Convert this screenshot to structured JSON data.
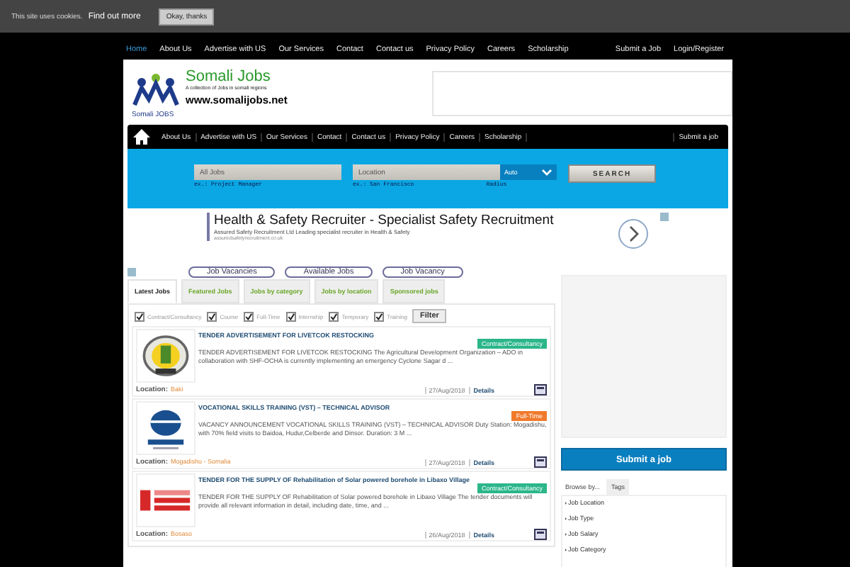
{
  "cookie_bar": {
    "text": "This site uses cookies.",
    "link": "Find out more",
    "button": "Okay, thanks"
  },
  "top_nav": {
    "items": [
      {
        "label": "Home",
        "selected": true
      },
      {
        "label": "About Us",
        "selected": false
      },
      {
        "label": "Advertise with US",
        "selected": false
      },
      {
        "label": "Our Services",
        "selected": false
      },
      {
        "label": "Contact",
        "selected": false
      },
      {
        "label": "Contact us",
        "selected": false
      },
      {
        "label": "Privacy Policy",
        "selected": false
      },
      {
        "label": "Careers",
        "selected": false
      },
      {
        "label": "Scholarship",
        "selected": false
      }
    ],
    "right": [
      "Submit a Job",
      "Login/Register"
    ]
  },
  "logo": {
    "title": "Somali Jobs",
    "tagline": "A collection of Jobs in somali regions",
    "url": "www.somalijobs.net",
    "badge": "Somali JOBS"
  },
  "main_nav": {
    "items": [
      "About Us",
      "Advertise with US",
      "Our Services",
      "Contact",
      "Contact us",
      "Privacy Policy",
      "Careers",
      "Scholarship"
    ],
    "right": "Submit a job"
  },
  "search": {
    "keyword": {
      "placeholder": "All Jobs",
      "hint": "ex.: Project Manager"
    },
    "location": {
      "placeholder": "Location",
      "hint": "ex.: San Francisco"
    },
    "radius": {
      "value": "Auto",
      "hint": "Radius"
    },
    "button": "SEARCH"
  },
  "ad": {
    "title": "Health & Safety Recruiter - Specialist Safety Recruitment",
    "text": "Assured Safety Recruitment Ltd Leading specialist recruiter in Health & Safety",
    "url": "assuredsafetyrecruitment.co.uk"
  },
  "link_buttons": [
    "Job Vacancies",
    "Available Jobs",
    "Job Vacancy"
  ],
  "tabs": [
    {
      "label": "Latest Jobs",
      "selected": true
    },
    {
      "label": "Featured Jobs",
      "selected": false
    },
    {
      "label": "Jobs by category",
      "selected": false
    },
    {
      "label": "Jobs by location",
      "selected": false
    },
    {
      "label": "Sponsored jobs",
      "selected": false
    }
  ],
  "filters": [
    {
      "label": "Contract/Consultancy",
      "checked": true
    },
    {
      "label": "Course",
      "checked": true
    },
    {
      "label": "Full-Time",
      "checked": true
    },
    {
      "label": "Internship",
      "checked": true
    },
    {
      "label": "Temporary",
      "checked": true
    },
    {
      "label": "Training",
      "checked": true
    }
  ],
  "filter_button": "Filter",
  "jobs": [
    {
      "title": "TENDER ADVERTISEMENT FOR LIVETCOK RESTOCKING",
      "type": "Contract/Consultancy",
      "color": "#2bb68a",
      "description": "TENDER ADVERTISEMENT FOR LIVETCOK RESTOCKING The Agricultural Development Organization – ADO in collaboration with SHF-OCHA is currently implementing an emergency Cyclone Sagar d ...",
      "location_label": "Location:",
      "location": "Baki",
      "date": "27/Aug/2018",
      "details": "Details"
    },
    {
      "title": "VOCATIONAL SKILLS TRAINING (VST) – TECHNICAL ADVISOR",
      "type": "Full-Time",
      "color": "#f07a2c",
      "description": "VACANCY ANNOUNCEMENT VOCATIONAL SKILLS TRAINING (VST) – TECHNICAL ADVISOR    Duty Station: Mogadishu, with 70% field visits to Baidoa, Hudur,Celberde and Dinsor. Duration: 3 M ...",
      "location_label": "Location:",
      "location": "Mogadishu - Somalia",
      "date": "27/Aug/2018",
      "details": "Details"
    },
    {
      "title": "TENDER FOR THE SUPPLY OF Rehabilitation of Solar powered borehole in Libaxo Village",
      "type": "Contract/Consultancy",
      "color": "#2bb68a",
      "description": "TENDER FOR THE SUPPLY OF Rehabilitation of Solar powered borehole in Libaxo Village The tender documents will provide all relevant information in detail, including date, time, and ...",
      "location_label": "Location:",
      "location": "Bosaso",
      "date": "26/Aug/2018",
      "details": "Details"
    }
  ],
  "sidebar": {
    "button": "Submit a job",
    "tabs": [
      {
        "label": "Browse by...",
        "selected": true
      },
      {
        "label": "Tags",
        "selected": false
      }
    ],
    "items": [
      "Job Location",
      "Job Type",
      "Job Salary",
      "Job Category"
    ]
  }
}
